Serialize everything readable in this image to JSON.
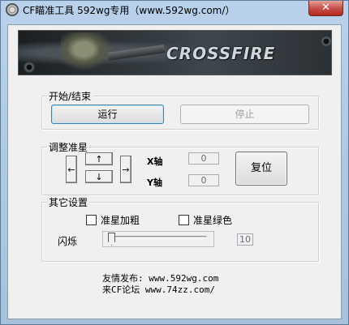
{
  "window": {
    "title": "CF瞄准工具   592wg专用（www.592wg.com/）",
    "close_label": "✕"
  },
  "banner": {
    "logo_text": "CROSSFIRE"
  },
  "start_group": {
    "label": "开始/结束",
    "run_label": "运行",
    "stop_label": "停止"
  },
  "adjust_group": {
    "label": "调整准星",
    "up": "↑",
    "down": "↓",
    "left": "←",
    "right": "→",
    "x_label": "X轴",
    "y_label": "Y轴",
    "x_value": "0",
    "y_value": "0",
    "reset_label": "复位"
  },
  "other_group": {
    "label": "其它设置",
    "bold_label": "准星加粗",
    "green_label": "准星绿色",
    "blink_label": "闪烁",
    "blink_value": "10",
    "blink_position": 0.0
  },
  "footer": {
    "line1": "友情发布: www.592wg.com",
    "line2": "来CF论坛 www.74zz.com/"
  }
}
